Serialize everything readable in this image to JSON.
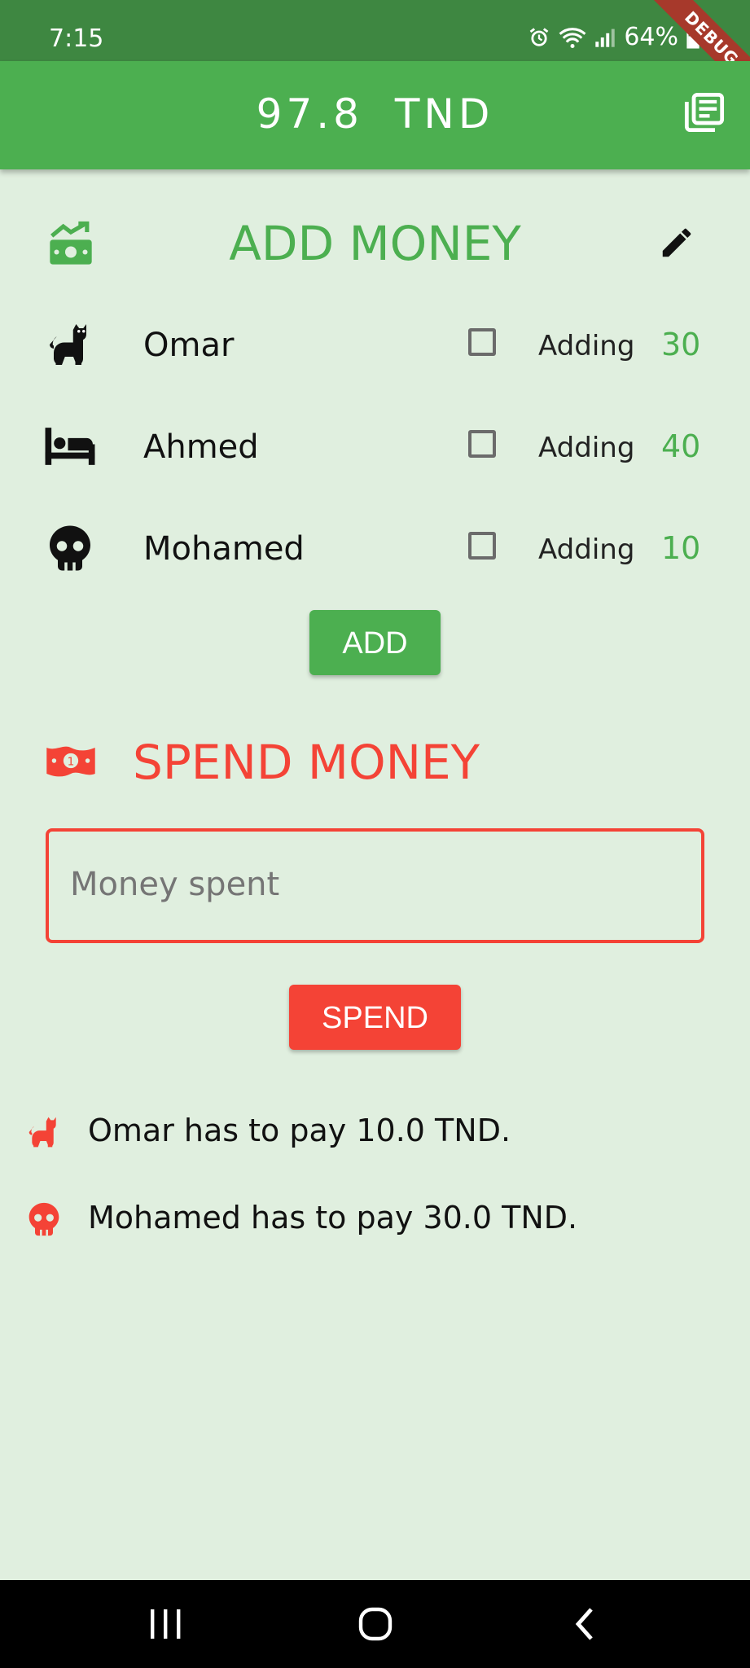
{
  "status_bar": {
    "time": "7:15",
    "battery": "64%",
    "debug": "DEBUG"
  },
  "app_bar": {
    "balance": "97.8 TND",
    "ledger_icon": "ledger-icon"
  },
  "add_section": {
    "title": "ADD MONEY",
    "icon": "money-growth-icon",
    "edit_icon": "edit-icon",
    "people": [
      {
        "name": "Omar",
        "icon": "cat-icon",
        "adding_label": "Adding",
        "amount": "30",
        "checked": false
      },
      {
        "name": "Ahmed",
        "icon": "bed-icon",
        "adding_label": "Adding",
        "amount": "40",
        "checked": false
      },
      {
        "name": "Mohamed",
        "icon": "skull-icon",
        "adding_label": "Adding",
        "amount": "10",
        "checked": false
      }
    ],
    "button": "ADD"
  },
  "spend_section": {
    "title": "SPEND MONEY",
    "icon": "banknote-icon",
    "input_placeholder": "Money spent",
    "button": "SPEND"
  },
  "debts": [
    {
      "icon": "cat-icon",
      "text": "Omar has to pay 10.0 TND."
    },
    {
      "icon": "skull-icon",
      "text": "Mohamed has to pay 30.0 TND."
    }
  ],
  "colors": {
    "green": "#4caf50",
    "red": "#f44336",
    "background": "#e0efdf",
    "status": "#3e8741"
  }
}
